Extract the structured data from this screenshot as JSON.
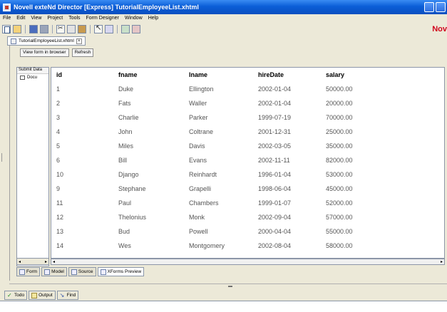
{
  "window": {
    "title": "Novell exteNd Director [Express] TutorialEmployeeList.xhtml"
  },
  "menubar": {
    "items": [
      "File",
      "Edit",
      "View",
      "Project",
      "Tools",
      "Form Designer",
      "Window",
      "Help"
    ]
  },
  "brand": {
    "text": "Nov",
    "color": "#d0021b"
  },
  "document_tab": {
    "label": "TutorialEmployeeList.xhtml"
  },
  "buttons": {
    "view_in_browser": "View form in browser",
    "refresh": "Refresh"
  },
  "left_panel": {
    "header": "Submit Data",
    "tree_item": "Docu"
  },
  "table": {
    "columns": [
      "id",
      "fname",
      "lname",
      "hireDate",
      "salary"
    ],
    "rows": [
      [
        "1",
        "Duke",
        "Ellington",
        "2002-01-04",
        "50000.00"
      ],
      [
        "2",
        "Fats",
        "Waller",
        "2002-01-04",
        "20000.00"
      ],
      [
        "3",
        "Charlie",
        "Parker",
        "1999-07-19",
        "70000.00"
      ],
      [
        "4",
        "John",
        "Coltrane",
        "2001-12-31",
        "25000.00"
      ],
      [
        "5",
        "Miles",
        "Davis",
        "2002-03-05",
        "35000.00"
      ],
      [
        "6",
        "Bill",
        "Evans",
        "2002-11-11",
        "82000.00"
      ],
      [
        "10",
        "Django",
        "Reinhardt",
        "1996-01-04",
        "53000.00"
      ],
      [
        "9",
        "Stephane",
        "Grapelli",
        "1998-06-04",
        "45000.00"
      ],
      [
        "11",
        "Paul",
        "Chambers",
        "1999-01-07",
        "52000.00"
      ],
      [
        "12",
        "Thelonius",
        "Monk",
        "2002-09-04",
        "57000.00"
      ],
      [
        "13",
        "Bud",
        "Powell",
        "2000-04-04",
        "55000.00"
      ],
      [
        "14",
        "Wes",
        "Montgomery",
        "2002-08-04",
        "58000.00"
      ]
    ]
  },
  "view_tabs": [
    {
      "label": "Form",
      "icon": "form-icon",
      "active": false
    },
    {
      "label": "Model",
      "icon": "model-icon",
      "active": false
    },
    {
      "label": "Source",
      "icon": "source-icon",
      "active": false
    },
    {
      "label": "XForms Preview",
      "icon": "xforms-preview-icon",
      "active": true
    }
  ],
  "bottom_tabs": [
    {
      "label": "Todo",
      "icon": "checkmark-icon"
    },
    {
      "label": "Output",
      "icon": "output-icon"
    },
    {
      "label": "Find",
      "icon": "find-icon"
    }
  ]
}
